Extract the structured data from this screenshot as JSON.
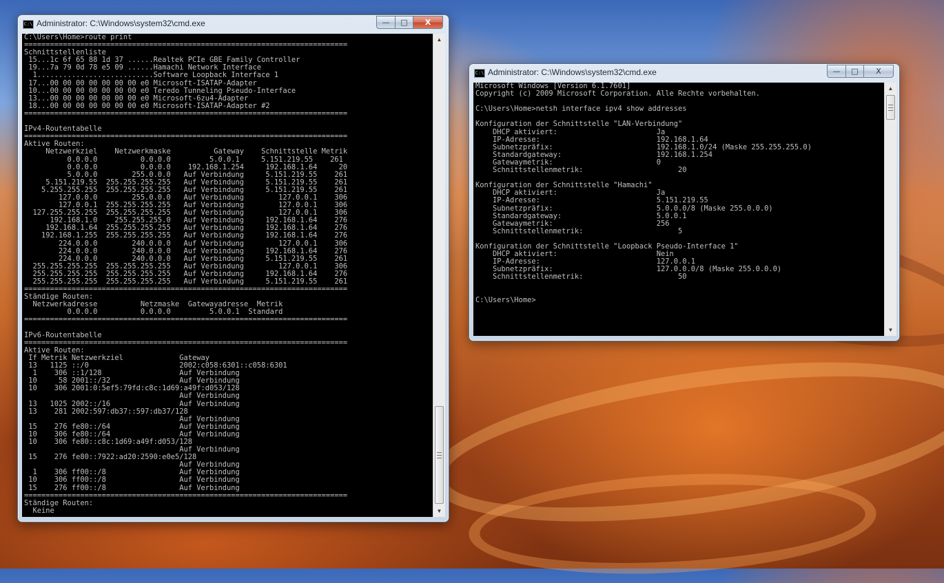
{
  "left_window": {
    "title": "Administrator: C:\\Windows\\system32\\cmd.exe",
    "icon": "cmd-icon",
    "lines": [
      "C:\\Users\\Home>route print",
      "===========================================================================",
      "Schnittstellenliste",
      " 15...1c 6f 65 88 1d 37 ......Realtek PCIe GBE Family Controller",
      " 19...7a 79 0d 78 e5 09 ......Hamachi Network Interface",
      "  1...........................Software Loopback Interface 1",
      " 17...00 00 00 00 00 00 00 e0 Microsoft-ISATAP-Adapter",
      " 10...00 00 00 00 00 00 00 e0 Teredo Tunneling Pseudo-Interface",
      " 13...00 00 00 00 00 00 00 e0 Microsoft-6zu4-Adapter",
      " 18...00 00 00 00 00 00 00 e0 Microsoft-ISATAP-Adapter #2",
      "===========================================================================",
      "",
      "IPv4-Routentabelle",
      "===========================================================================",
      "Aktive Routen:",
      "     Netzwerkziel    Netzwerkmaske          Gateway    Schnittstelle Metrik",
      "          0.0.0.0          0.0.0.0         5.0.0.1     5.151.219.55    261",
      "          0.0.0.0          0.0.0.0    192.168.1.254     192.168.1.64     20",
      "          5.0.0.0        255.0.0.0   Auf Verbindung     5.151.219.55    261",
      "     5.151.219.55  255.255.255.255   Auf Verbindung     5.151.219.55    261",
      "    5.255.255.255  255.255.255.255   Auf Verbindung     5.151.219.55    261",
      "        127.0.0.0        255.0.0.0   Auf Verbindung        127.0.0.1    306",
      "        127.0.0.1  255.255.255.255   Auf Verbindung        127.0.0.1    306",
      "  127.255.255.255  255.255.255.255   Auf Verbindung        127.0.0.1    306",
      "      192.168.1.0    255.255.255.0   Auf Verbindung     192.168.1.64    276",
      "     192.168.1.64  255.255.255.255   Auf Verbindung     192.168.1.64    276",
      "    192.168.1.255  255.255.255.255   Auf Verbindung     192.168.1.64    276",
      "        224.0.0.0        240.0.0.0   Auf Verbindung        127.0.0.1    306",
      "        224.0.0.0        240.0.0.0   Auf Verbindung     192.168.1.64    276",
      "        224.0.0.0        240.0.0.0   Auf Verbindung     5.151.219.55    261",
      "  255.255.255.255  255.255.255.255   Auf Verbindung        127.0.0.1    306",
      "  255.255.255.255  255.255.255.255   Auf Verbindung     192.168.1.64    276",
      "  255.255.255.255  255.255.255.255   Auf Verbindung     5.151.219.55    261",
      "===========================================================================",
      "Ständige Routen:",
      "  Netzwerkadresse          Netzmaske  Gatewayadresse  Metrik",
      "          0.0.0.0          0.0.0.0         5.0.0.1  Standard",
      "===========================================================================",
      "",
      "IPv6-Routentabelle",
      "===========================================================================",
      "Aktive Routen:",
      " If Metrik Netzwerkziel             Gateway",
      " 13   1125 ::/0                     2002:c058:6301::c058:6301",
      "  1    306 ::1/128                  Auf Verbindung",
      " 10     58 2001::/32                Auf Verbindung",
      " 10    306 2001:0:5ef5:79fd:c8c:1d69:a49f:d053/128",
      "                                    Auf Verbindung",
      " 13   1025 2002::/16                Auf Verbindung",
      " 13    281 2002:597:db37::597:db37/128",
      "                                    Auf Verbindung",
      " 15    276 fe80::/64                Auf Verbindung",
      " 10    306 fe80::/64                Auf Verbindung",
      " 10    306 fe80::c8c:1d69:a49f:d053/128",
      "                                    Auf Verbindung",
      " 15    276 fe80::7922:ad20:2590:e0e5/128",
      "                                    Auf Verbindung",
      "  1    306 ff00::/8                 Auf Verbindung",
      " 10    306 ff00::/8                 Auf Verbindung",
      " 15    276 ff00::/8                 Auf Verbindung",
      "===========================================================================",
      "Ständige Routen:",
      "  Keine"
    ]
  },
  "right_window": {
    "title": "Administrator: C:\\Windows\\system32\\cmd.exe",
    "icon": "cmd-icon",
    "lines": [
      "Microsoft Windows [Version 6.1.7601]",
      "Copyright (c) 2009 Microsoft Corporation. Alle Rechte vorbehalten.",
      "",
      "C:\\Users\\Home>netsh interface ipv4 show addresses",
      "",
      "Konfiguration der Schnittstelle \"LAN-Verbindung\"",
      "    DHCP aktiviert:                       Ja",
      "    IP-Adresse:                           192.168.1.64",
      "    Subnetzpräfix:                        192.168.1.0/24 (Maske 255.255.255.0)",
      "    Standardgateway:                      192.168.1.254",
      "    Gatewaymetrik:                        0",
      "    Schnittstellenmetrik:                      20",
      "",
      "Konfiguration der Schnittstelle \"Hamachi\"",
      "    DHCP aktiviert:                       Ja",
      "    IP-Adresse:                           5.151.219.55",
      "    Subnetzpräfix:                        5.0.0.0/8 (Maske 255.0.0.0)",
      "    Standardgateway:                      5.0.0.1",
      "    Gatewaymetrik:                        256",
      "    Schnittstellenmetrik:                      5",
      "",
      "Konfiguration der Schnittstelle \"Loopback Pseudo-Interface 1\"",
      "    DHCP aktiviert:                       Nein",
      "    IP-Adresse:                           127.0.0.1",
      "    Subnetzpräfix:                        127.0.0.0/8 (Maske 255.0.0.0)",
      "    Schnittstellenmetrik:                      50",
      "",
      "",
      "C:\\Users\\Home>"
    ]
  },
  "controls": {
    "minimize": "—",
    "maximize": "□",
    "close": "X"
  },
  "scroll": {
    "up_arrow": "▲",
    "down_arrow": "▼"
  }
}
